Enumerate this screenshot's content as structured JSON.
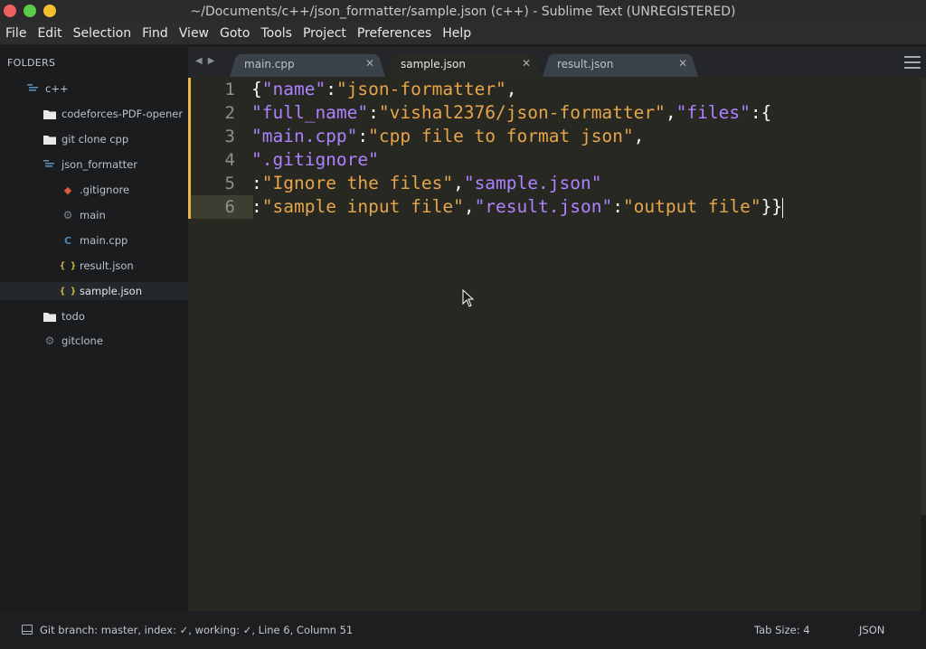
{
  "window": {
    "title": "~/Documents/c++/json_formatter/sample.json (c++) - Sublime Text (UNREGISTERED)"
  },
  "menu": [
    "File",
    "Edit",
    "Selection",
    "Find",
    "View",
    "Goto",
    "Tools",
    "Project",
    "Preferences",
    "Help"
  ],
  "sidebar": {
    "header": "FOLDERS",
    "items": [
      {
        "label": "c++",
        "icon": "folder-open-icon"
      },
      {
        "label": "codeforces-PDF-opener",
        "icon": "folder-icon"
      },
      {
        "label": "git clone cpp",
        "icon": "folder-icon"
      },
      {
        "label": "json_formatter",
        "icon": "folder-open-icon"
      },
      {
        "label": ".gitignore",
        "icon": "git-icon"
      },
      {
        "label": "main",
        "icon": "gear-icon"
      },
      {
        "label": "main.cpp",
        "icon": "cpp-icon"
      },
      {
        "label": "result.json",
        "icon": "json-braces-icon"
      },
      {
        "label": "sample.json",
        "icon": "json-braces-icon",
        "selected": true
      },
      {
        "label": "todo",
        "icon": "folder-icon"
      },
      {
        "label": "gitclone",
        "icon": "gear-icon"
      }
    ]
  },
  "tabs": [
    {
      "label": "main.cpp",
      "active": false
    },
    {
      "label": "sample.json",
      "active": true
    },
    {
      "label": "result.json",
      "active": false
    }
  ],
  "editor": {
    "line_numbers": [
      "1",
      "2",
      "3",
      "4",
      "5",
      "6"
    ],
    "lines": [
      [
        {
          "t": "p",
          "v": "{"
        },
        {
          "t": "k",
          "v": "\"name\""
        },
        {
          "t": "p",
          "v": ":"
        },
        {
          "t": "s",
          "v": "\"json-formatter\""
        },
        {
          "t": "p",
          "v": ","
        }
      ],
      [
        {
          "t": "k",
          "v": "\"full_name\""
        },
        {
          "t": "p",
          "v": ":"
        },
        {
          "t": "s",
          "v": "\"vishal2376/json-formatter\""
        },
        {
          "t": "p",
          "v": ","
        },
        {
          "t": "k",
          "v": "\"files\""
        },
        {
          "t": "p",
          "v": ":{"
        }
      ],
      [
        {
          "t": "k",
          "v": "\"main.cpp\""
        },
        {
          "t": "p",
          "v": ":"
        },
        {
          "t": "s",
          "v": "\"cpp file to format json\""
        },
        {
          "t": "p",
          "v": ","
        }
      ],
      [
        {
          "t": "k",
          "v": "\".gitignore\""
        }
      ],
      [
        {
          "t": "p",
          "v": ":"
        },
        {
          "t": "s",
          "v": "\"Ignore the files\""
        },
        {
          "t": "p",
          "v": ","
        },
        {
          "t": "k",
          "v": "\"sample.json\""
        }
      ],
      [
        {
          "t": "p",
          "v": ":"
        },
        {
          "t": "s",
          "v": "\"sample input file\""
        },
        {
          "t": "p",
          "v": ","
        },
        {
          "t": "k",
          "v": "\"result.json\""
        },
        {
          "t": "p",
          "v": ":"
        },
        {
          "t": "s",
          "v": "\"output file\""
        },
        {
          "t": "p",
          "v": "}}"
        }
      ]
    ],
    "current_line": 6
  },
  "statusbar": {
    "text": "Git branch: master, index: ✓, working: ✓, Line 6, Column 51",
    "tab_size": "Tab Size: 4",
    "syntax": "JSON"
  },
  "colors": {
    "key": "#ae81ff",
    "string": "#e6a54a",
    "modified_marker": "#e8b64a"
  }
}
